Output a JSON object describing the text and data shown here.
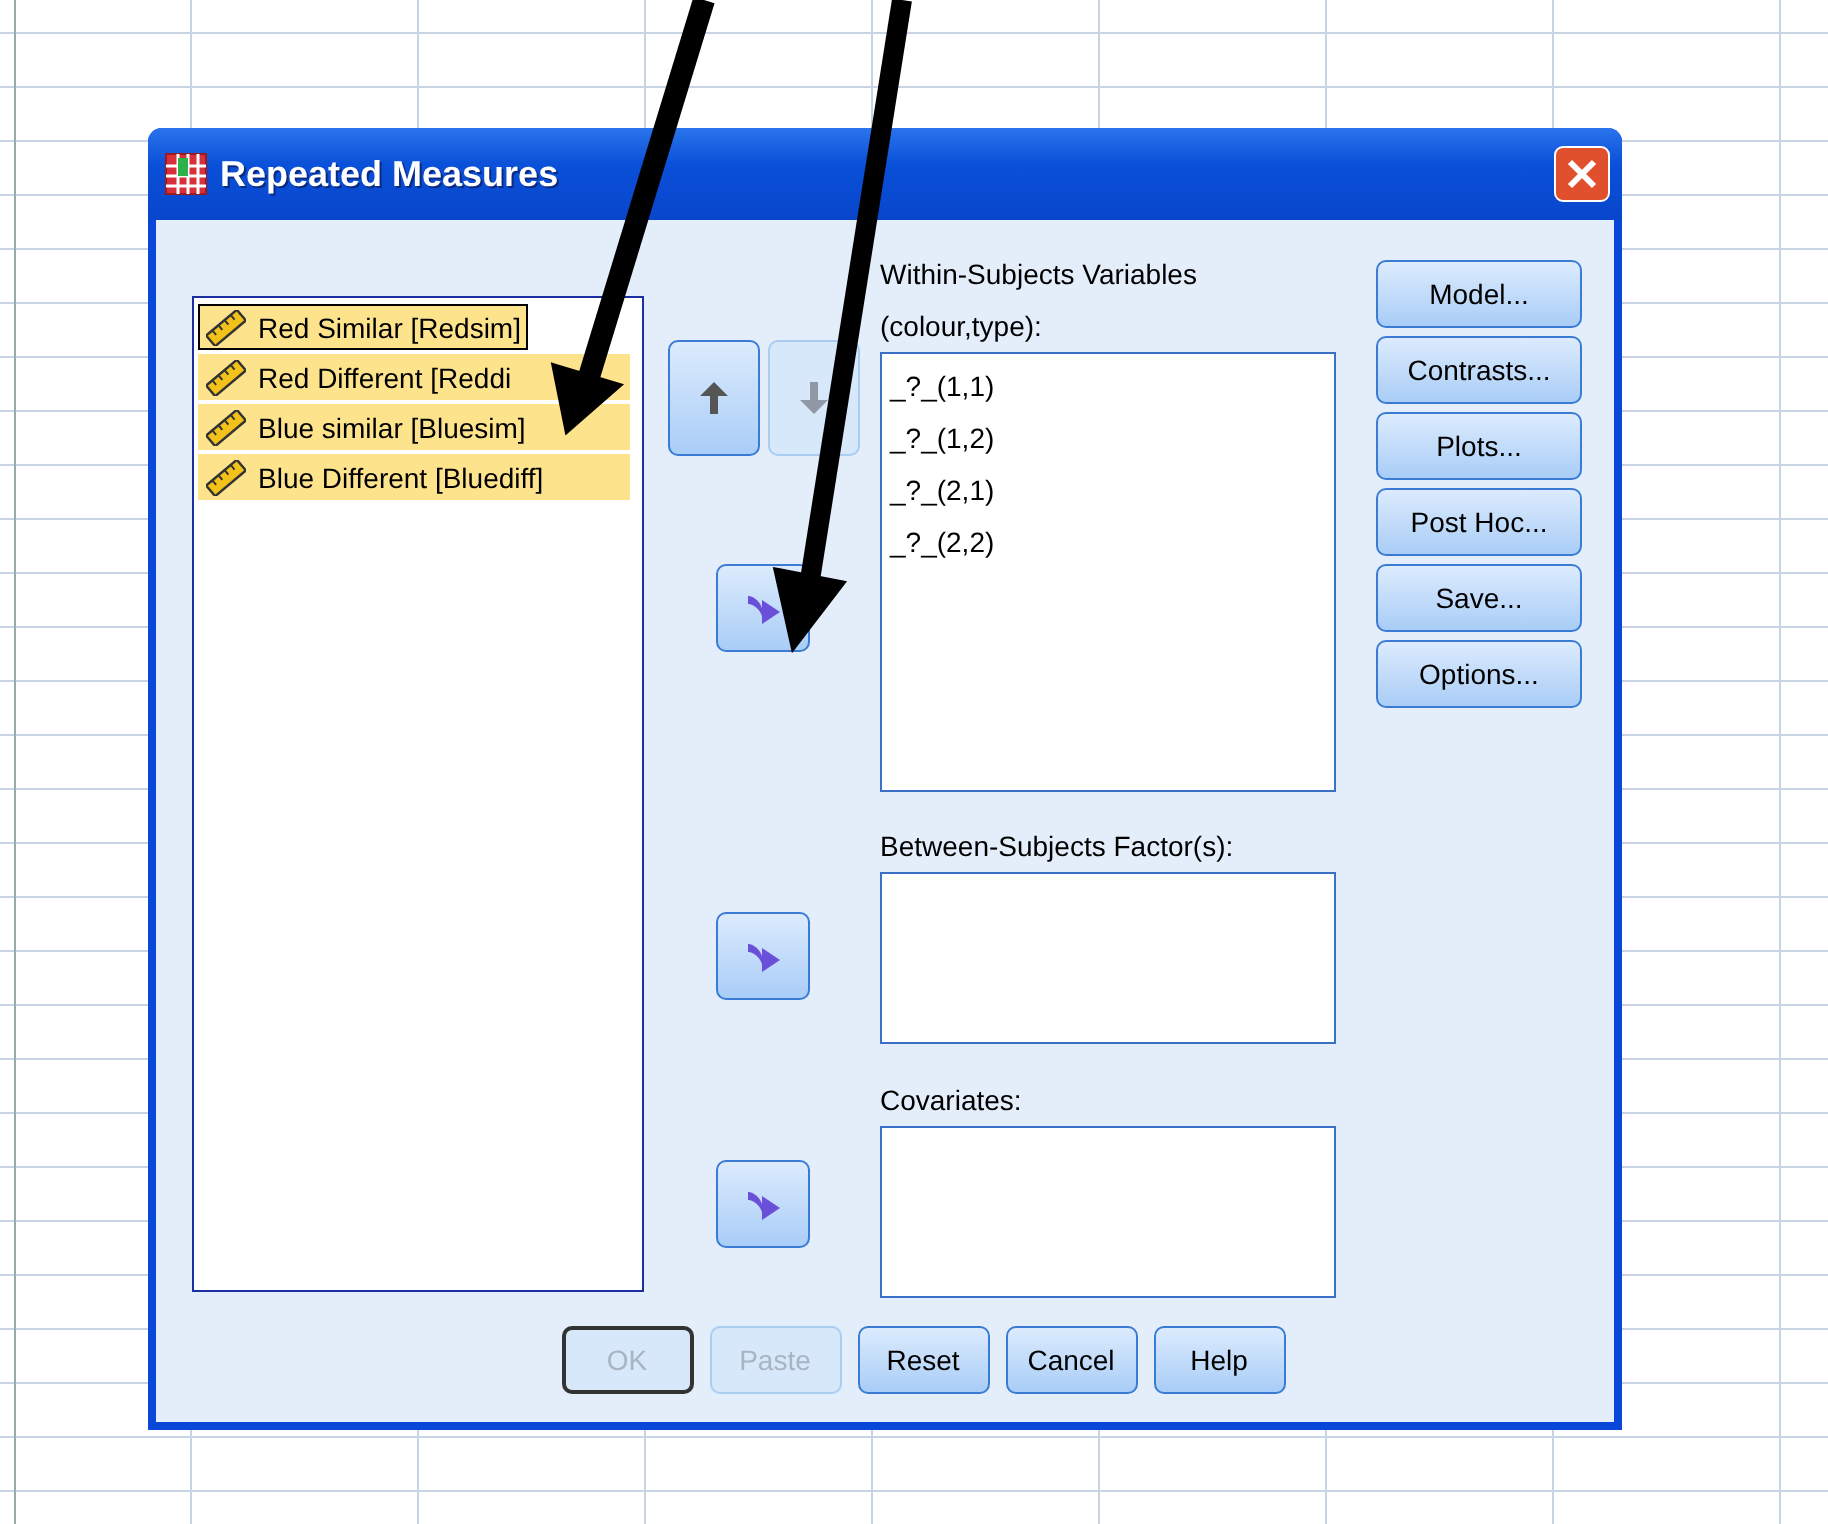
{
  "window": {
    "title": "Repeated Measures"
  },
  "source_variables": [
    {
      "label": "Red Similar [Redsim]",
      "selected": true,
      "focused": true
    },
    {
      "label": "Red Different [Reddi",
      "selected": true,
      "focused": false
    },
    {
      "label": "Blue similar [Bluesim]",
      "selected": true,
      "focused": false
    },
    {
      "label": "Blue Different [Bluediff]",
      "selected": true,
      "focused": false
    }
  ],
  "order_buttons": [
    {
      "kind": "up",
      "disabled": false
    },
    {
      "kind": "down",
      "disabled": true
    }
  ],
  "target_lists": [
    {
      "label": "Within-Subjects Variables",
      "sublabel": "(colour,type):",
      "items": [
        "_?_(1,1)",
        "_?_(1,2)",
        "_?_(2,1)",
        "_?_(2,2)"
      ]
    },
    {
      "label": "Between-Subjects Factor(s):"
    },
    {
      "label": "Covariates:"
    }
  ],
  "side_buttons": [
    {
      "label": "Model..."
    },
    {
      "label": "Contrasts..."
    },
    {
      "label": "Plots..."
    },
    {
      "label": "Post Hoc..."
    },
    {
      "label": "Save..."
    },
    {
      "label": "Options..."
    }
  ],
  "bottom_buttons": [
    {
      "label": "OK",
      "disabled": true,
      "default": true
    },
    {
      "label": "Paste",
      "disabled": true,
      "default": false
    },
    {
      "label": "Reset",
      "disabled": false,
      "default": false
    },
    {
      "label": "Cancel",
      "disabled": false,
      "default": false
    },
    {
      "label": "Help",
      "disabled": false,
      "default": false
    }
  ]
}
